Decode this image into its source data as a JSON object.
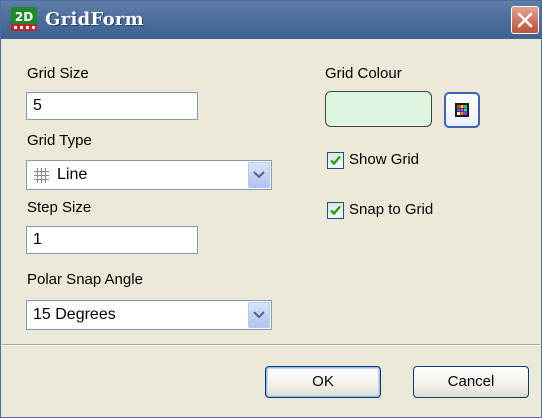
{
  "window": {
    "title": "GridForm",
    "app_icon": "2d-app-icon",
    "close_icon": "close-icon"
  },
  "fields": {
    "grid_size": {
      "label": "Grid Size",
      "value": "5"
    },
    "grid_type": {
      "label": "Grid Type",
      "value": "Line",
      "icon": "grid-line-icon"
    },
    "step_size": {
      "label": "Step Size",
      "value": "1"
    },
    "polar_snap_angle": {
      "label": "Polar Snap Angle",
      "value": "15 Degrees"
    }
  },
  "grid_colour": {
    "label": "Grid Colour",
    "value_color": "#ddf6e1",
    "picker_icon": "color-palette-icon"
  },
  "options": {
    "show_grid": {
      "label": "Show Grid",
      "checked": true
    },
    "snap_to_grid": {
      "label": "Snap to Grid",
      "checked": true
    }
  },
  "buttons": {
    "ok_label": "OK",
    "cancel_label": "Cancel"
  },
  "colors": {
    "titlebar": "#4d6f9f",
    "dialog_bg": "#ece9d8",
    "close_button": "#cc6e57",
    "input_border": "#7f9db9",
    "button_border": "#003c74"
  }
}
